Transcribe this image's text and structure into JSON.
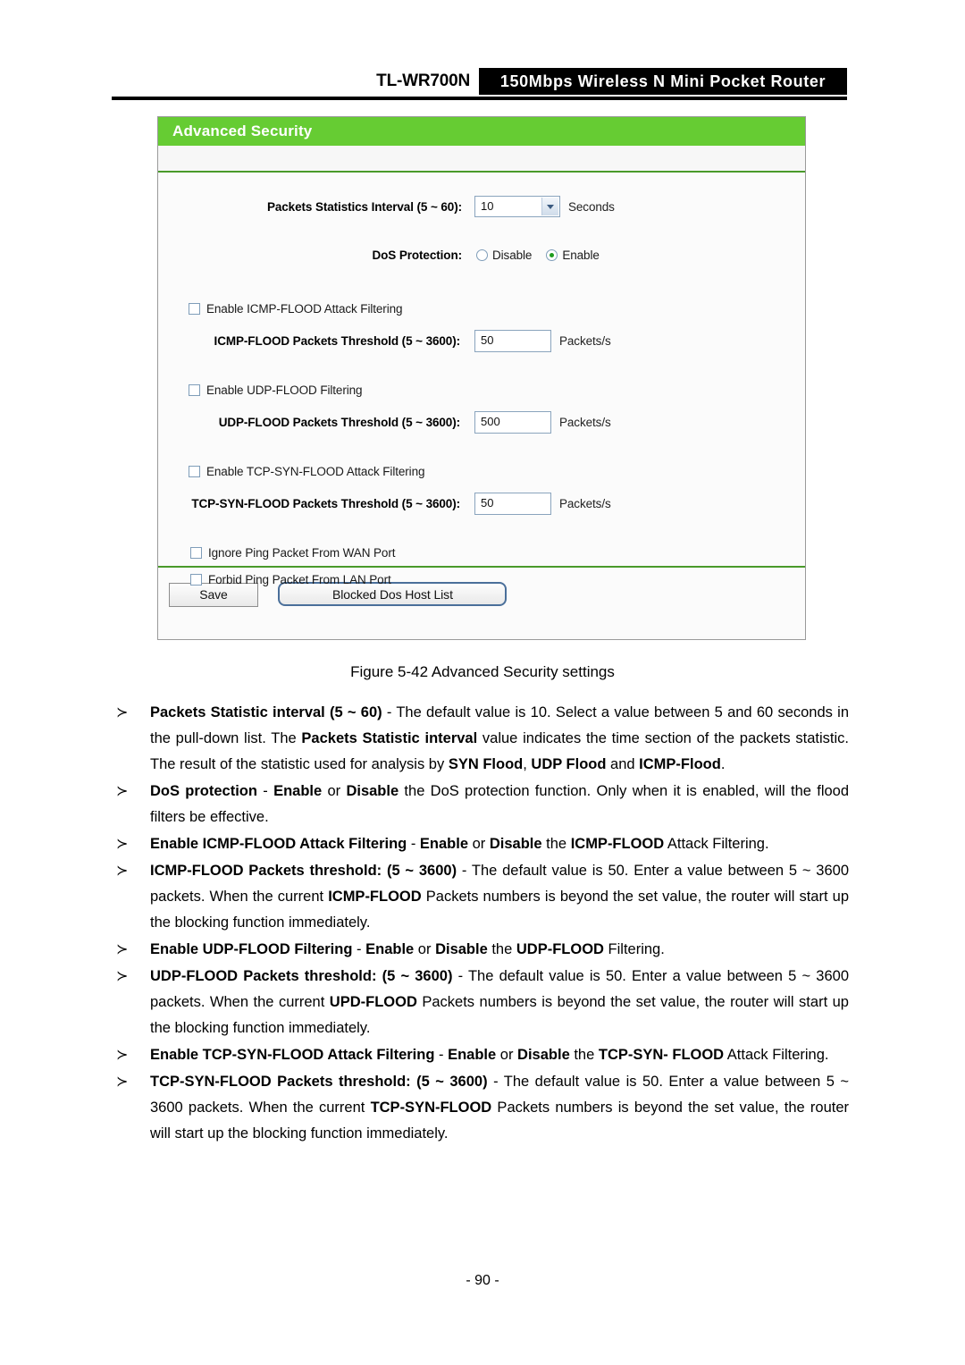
{
  "header": {
    "model": "TL-WR700N",
    "banner": "150Mbps Wireless N Mini Pocket Router"
  },
  "panel": {
    "title": "Advanced Security",
    "rows": {
      "packets_interval_label": "Packets Statistics Interval (5 ~ 60):",
      "packets_interval_value": "10",
      "packets_interval_unit": "Seconds",
      "dos_protection_label": "DoS Protection:",
      "dos_disable_label": "Disable",
      "dos_enable_label": "Enable",
      "icmp_checkbox_label": "Enable ICMP-FLOOD Attack Filtering",
      "icmp_threshold_label": "ICMP-FLOOD Packets Threshold (5 ~ 3600):",
      "icmp_threshold_value": "50",
      "icmp_threshold_unit": "Packets/s",
      "udp_checkbox_label": "Enable UDP-FLOOD Filtering",
      "udp_threshold_label": "UDP-FLOOD Packets Threshold (5 ~ 3600):",
      "udp_threshold_value": "500",
      "udp_threshold_unit": "Packets/s",
      "tcp_checkbox_label": "Enable TCP-SYN-FLOOD Attack Filtering",
      "tcp_threshold_label": "TCP-SYN-FLOOD Packets Threshold (5 ~ 3600):",
      "tcp_threshold_value": "50",
      "tcp_threshold_unit": "Packets/s",
      "ignore_ping_wan_label": "Ignore Ping Packet From WAN Port",
      "forbid_ping_lan_label": "Forbid Ping Packet From LAN Port"
    },
    "buttons": {
      "save": "Save",
      "blocked_dos_host_list": "Blocked Dos Host List"
    },
    "colors": {
      "title_bar": "#66cc33",
      "separator": "#4a9a2a",
      "radio_dot": "#1f9c1f"
    }
  },
  "figure_caption": "Figure 5-42 Advanced Security settings",
  "bullets": [
    {
      "mark": "≻",
      "html": "<b>Packets Statistic interval (5 ~ 60)</b> - The default value is 10. Select a value between 5 and 60 seconds in the pull-down list. The <b>Packets Statistic interval</b> value indicates the time section of the packets statistic. The result of the statistic used for analysis by <b>SYN Flood</b>, <b>UDP Flood</b> and <b>ICMP-Flood</b>."
    },
    {
      "mark": "≻",
      "html": "<b>DoS protection</b> - <b>Enable</b> or <b>Disable</b> the DoS protection function. Only when it is enabled, will the flood filters be effective."
    },
    {
      "mark": "≻",
      "html": "<b>Enable ICMP-FLOOD Attack Filtering</b> - <b>Enable</b> or <b>Disable</b> the <b>ICMP-FLOOD</b> Attack Filtering."
    },
    {
      "mark": "≻",
      "html": "<b>ICMP-FLOOD Packets threshold: (5 ~ 3600)</b> - The default value is 50. Enter a value between 5 ~ 3600 packets. When the current <b>ICMP-FLOOD</b> Packets numbers is beyond the set value, the router will start up the blocking function immediately."
    },
    {
      "mark": "≻",
      "html": "<b>Enable UDP-FLOOD Filtering</b> - <b>Enable</b> or <b>Disable</b> the <b>UDP-FLOOD</b> Filtering."
    },
    {
      "mark": "≻",
      "html": "<b>UDP-FLOOD Packets threshold: (5 ~ 3600)</b> - The default value is 50. Enter a value between 5 ~ 3600 packets. When the current <b>UPD-FLOOD</b> Packets numbers is beyond the set value, the router will start up the blocking function immediately."
    },
    {
      "mark": "≻",
      "html": "<b>Enable TCP-SYN-FLOOD Attack Filtering</b> - <b>Enable</b> or <b>Disable</b> the <b>TCP-SYN- FLOOD</b> Attack Filtering."
    },
    {
      "mark": "≻",
      "html": "<b>TCP-SYN-FLOOD Packets threshold: (5 ~ 3600)</b> - The default value is 50. Enter a value between 5 ~ 3600 packets. When the current <b>TCP-SYN-FLOOD</b> Packets numbers is beyond the set value, the router will start up the blocking function immediately."
    }
  ],
  "page_number": "- 90 -"
}
